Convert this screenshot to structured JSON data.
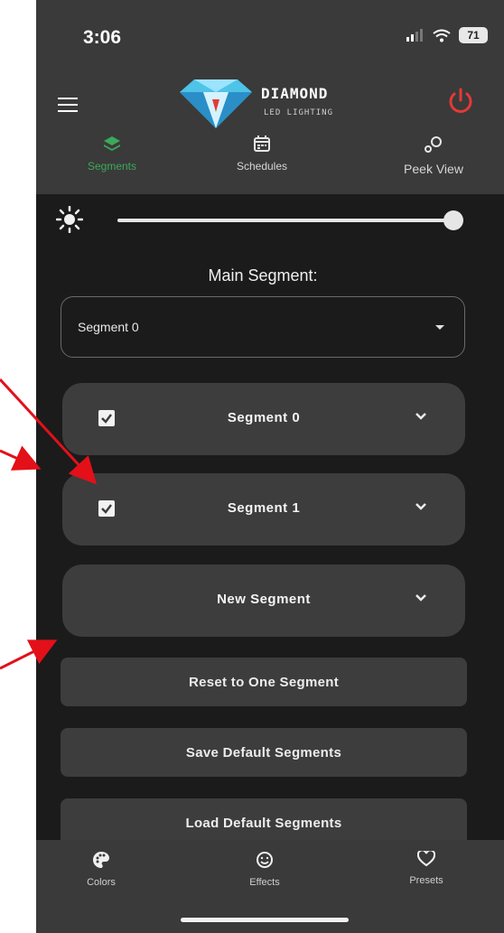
{
  "status_bar": {
    "time": "3:06",
    "battery": "71"
  },
  "header": {
    "logo_title": "DIAMOND",
    "logo_sub": "LED LIGHTING"
  },
  "tabs": [
    {
      "label": "Segments",
      "icon": "layers-icon",
      "active": true
    },
    {
      "label": "Schedules",
      "icon": "calendar-icon",
      "active": false
    },
    {
      "label": "Peek View",
      "icon": "peek-icon",
      "active": false
    }
  ],
  "brightness": {
    "value": 1.0
  },
  "main_segment": {
    "label": "Main Segment:",
    "selected": "Segment 0"
  },
  "segments": [
    {
      "title": "Segment 0",
      "checked": true
    },
    {
      "title": "Segment 1",
      "checked": true
    },
    {
      "title": "New Segment",
      "checked": false
    }
  ],
  "buttons": {
    "reset": "Reset to One Segment",
    "save_default": "Save Default Segments",
    "load_default": "Load Default Segments"
  },
  "bottom_nav": [
    {
      "label": "Colors",
      "icon": "palette-icon"
    },
    {
      "label": "Effects",
      "icon": "smiley-icon"
    },
    {
      "label": "Presets",
      "icon": "heart-icon"
    }
  ],
  "colors": {
    "accent": "#3ca95a",
    "power": "#e53935",
    "annotation_arrow": "#e3101a"
  }
}
